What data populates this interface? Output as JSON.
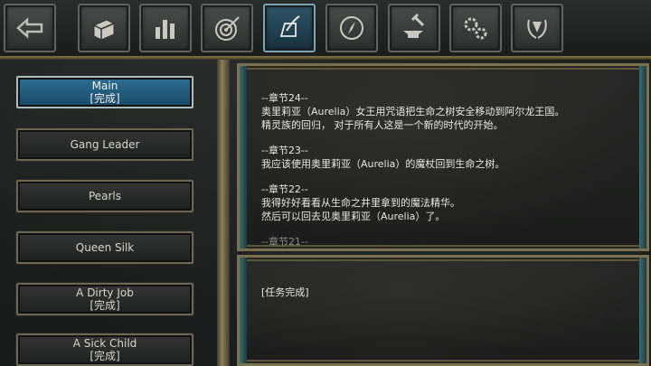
{
  "toolbar": {
    "buttons": [
      {
        "icon": "back-arrow-icon"
      },
      {
        "icon": "treasure-chest-icon"
      },
      {
        "icon": "stats-chart-icon"
      },
      {
        "icon": "target-icon"
      },
      {
        "icon": "quest-scroll-icon",
        "active": true
      },
      {
        "icon": "compass-icon"
      },
      {
        "icon": "anvil-hammer-icon"
      },
      {
        "icon": "gears-icon"
      },
      {
        "icon": "laurel-medal-icon"
      }
    ]
  },
  "quests": [
    {
      "name": "Main",
      "status": "[完成]"
    },
    {
      "name": "Gang Leader",
      "status": ""
    },
    {
      "name": "Pearls",
      "status": ""
    },
    {
      "name": "Queen Silk",
      "status": ""
    },
    {
      "name": "A Dirty Job",
      "status": "[完成]"
    },
    {
      "name": "A Sick Child",
      "status": "[完成]"
    }
  ],
  "story": {
    "ch24_title": "--章节24--",
    "ch24_line1": "奥里莉亚（Aurelia）女王用咒语把生命之树安全移动到阿尔龙王国。",
    "ch24_line2": "精灵族的回归， 对于所有人这是一个新的时代的开始。",
    "ch23_title": "--章节23--",
    "ch23_line1": "我应该使用奥里莉亚（Aurelia）的魔杖回到生命之树。",
    "ch22_title": "--章节22--",
    "ch22_line1": "我得好好看看从生命之井里拿到的魔法精华。",
    "ch22_line2": "然后可以回去见奥里莉亚（Aurelia）了。",
    "ch21_title": "--章节21--"
  },
  "status_text": "[任务完成]",
  "colors": {
    "selected_bg": "#2d6e93",
    "gold_trim": "#a3966a",
    "text": "#e8e8e2"
  }
}
